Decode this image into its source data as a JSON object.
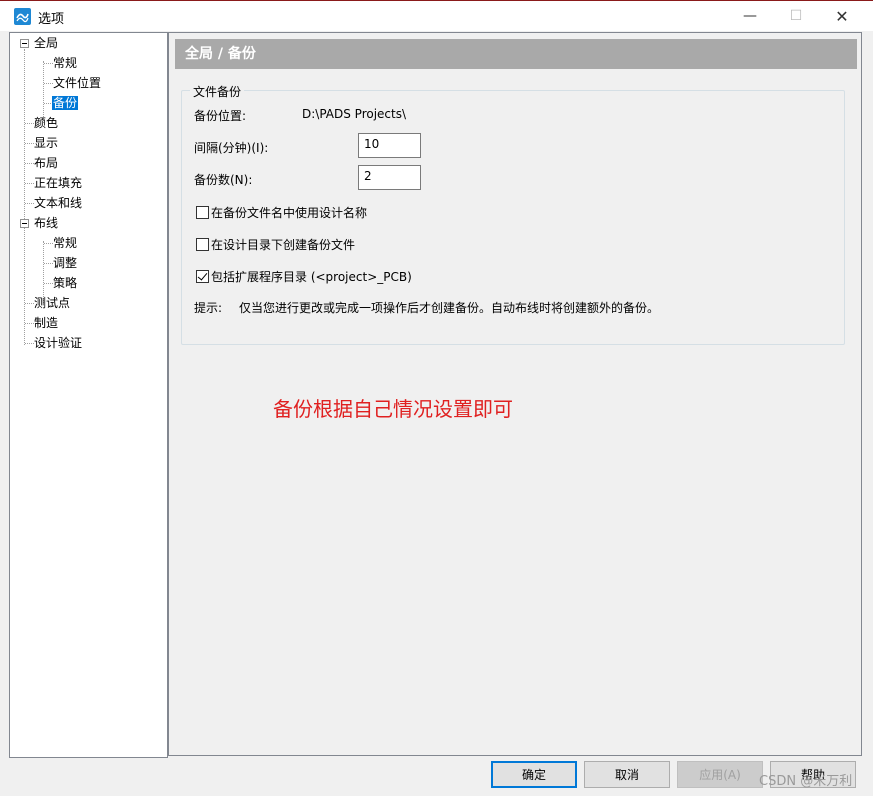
{
  "window": {
    "title": "选项",
    "minimize_glyph": "—",
    "maximize_glyph": "☐",
    "close_glyph": "✕"
  },
  "tree": {
    "items": [
      {
        "label": "全局"
      },
      {
        "label": "常规"
      },
      {
        "label": "文件位置"
      },
      {
        "label": "备份"
      },
      {
        "label": "颜色"
      },
      {
        "label": "显示"
      },
      {
        "label": "布局"
      },
      {
        "label": "正在填充"
      },
      {
        "label": "文本和线"
      },
      {
        "label": "布线"
      },
      {
        "label": "常规"
      },
      {
        "label": "调整"
      },
      {
        "label": "策略"
      },
      {
        "label": "测试点"
      },
      {
        "label": "制造"
      },
      {
        "label": "设计验证"
      }
    ],
    "selected": "备份"
  },
  "page": {
    "header": "全局 / 备份",
    "group_title": "文件备份",
    "location_label": "备份位置:",
    "location_value": "D:\\PADS Projects\\",
    "interval_label": "间隔(分钟)(I):",
    "interval_value": "10",
    "count_label": "备份数(N):",
    "count_value": "2",
    "opt1_label": "在备份文件名中使用设计名称",
    "opt1_checked": false,
    "opt2_label": "在设计目录下创建备份文件",
    "opt2_checked": false,
    "opt3_label": "包括扩展程序目录 (<project>_PCB)",
    "opt3_checked": true,
    "hint_label": "提示:",
    "hint_text": "仅当您进行更改或完成一项操作后才创建备份。自动布线时将创建额外的备份。"
  },
  "annotation": "备份根据自己情况设置即可",
  "buttons": {
    "ok": "确定",
    "cancel": "取消",
    "apply": "应用(A)",
    "help": "帮助"
  },
  "watermark": "CSDN @米万利",
  "colors": {
    "selection": "#0078d7",
    "header_bg": "#a9a9a9",
    "annotation": "#e02020"
  }
}
